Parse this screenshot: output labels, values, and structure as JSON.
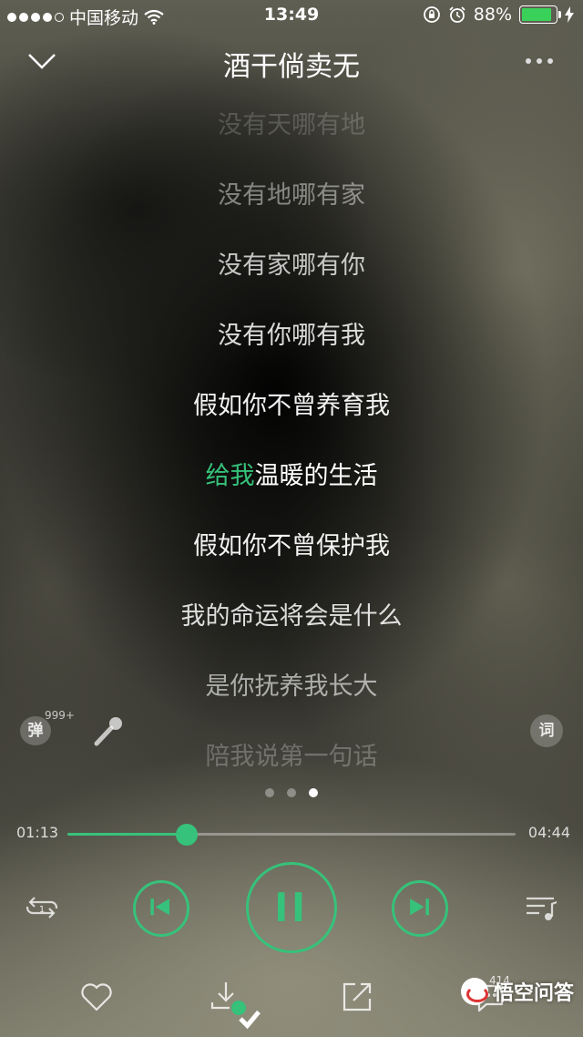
{
  "status_bar": {
    "carrier": "中国移动",
    "time": "13:49",
    "battery_percent": "88%",
    "battery_level": 0.88
  },
  "header": {
    "title": "酒干倘卖无",
    "back_icon": "chevron-down-icon",
    "more_icon": "more-horizontal-icon"
  },
  "lyrics": {
    "lines": [
      "没有天哪有地",
      "没有地哪有家",
      "没有家哪有你",
      "没有你哪有我",
      "假如你不曾养育我",
      "给我温暖的生活",
      "假如你不曾保护我",
      "我的命运将会是什么",
      "是你抚养我长大",
      "陪我说第一句话"
    ],
    "current_sung": "给我",
    "current_rest": "温暖的生活"
  },
  "side": {
    "danmu_label": "弹",
    "danmu_count": "999+",
    "lyric_label": "词"
  },
  "player": {
    "current_time": "01:13",
    "total_time": "04:44",
    "progress": 0.266,
    "accent_color": "#36c27a",
    "page_index": 2,
    "page_count": 3,
    "repeat_badge": "1"
  },
  "actions": {
    "comment_count": "414"
  },
  "watermark": {
    "text": "悟空问答"
  }
}
